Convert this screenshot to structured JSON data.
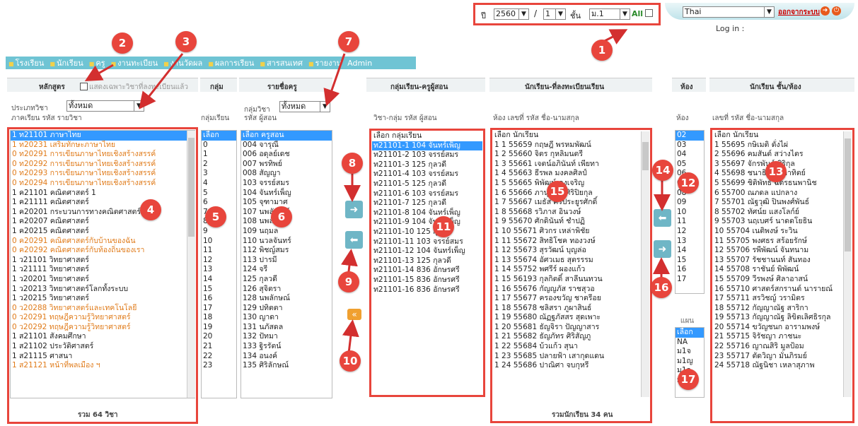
{
  "top": {
    "year_label": "ปี",
    "year_value": "2560",
    "slash": "/",
    "term_value": "1",
    "grade_label": "ชั้น",
    "grade_value": "ม.1",
    "all_label": "All",
    "language": "Thai",
    "logout": "ออกจากระบบ",
    "login_label": "Log in :"
  },
  "menu": [
    "โรงเรียน",
    "นักเรียน",
    "ครู",
    "งานทะเบียน",
    "งานวัดผล",
    "ผลการเรียน",
    "สารสนเทศ",
    "รายงาน",
    "Admin"
  ],
  "col1": {
    "header": "หลักสูตร",
    "checkbox_label": "แสดงเฉพาะวิชาที่ลงทะเบียนแล้ว",
    "type_label": "ประเภทวิชา",
    "type_value": "ทั้งหมด",
    "sub": "ภาคเรียน  รหัส  รายวิชา",
    "footer": "รวม  64 วิชา",
    "items": [
      {
        "t": "1 ท21101 ภาษาไทย",
        "c": "hl"
      },
      {
        "t": "1 ท20231 เสริมทักษะภาษาไทย",
        "c": "o"
      },
      {
        "t": "0 ท20291 การเขียนภาษาไทยเชิงสร้างสรรค์",
        "c": "o"
      },
      {
        "t": "0 ท20292 การเขียนภาษาไทยเชิงสร้างสรรค์",
        "c": "o"
      },
      {
        "t": "0 ท20293 การเขียนภาษาไทยเชิงสร้างสรรค์",
        "c": "o"
      },
      {
        "t": "0 ท20294 การเขียนภาษาไทยเชิงสร้างสรรค์",
        "c": "o"
      },
      {
        "t": "1 ค21101 คณิตศาสตร์ 1",
        "c": ""
      },
      {
        "t": "1 ค21111 คณิตศาสตร์",
        "c": ""
      },
      {
        "t": "1 ค20201 กระบวนการทางคณิตศาสตร์",
        "c": ""
      },
      {
        "t": "1 ค20207 คณิตศาสตร์",
        "c": ""
      },
      {
        "t": "1 ค20215 คณิตศาสตร์",
        "c": ""
      },
      {
        "t": "0 ค20291 คณิตศาสตร์กับบ้านของฉัน",
        "c": "o"
      },
      {
        "t": "0 ค20292 คณิตศาสตร์กับท้องถิ่นของเรา",
        "c": "o"
      },
      {
        "t": "1 ว21101 วิทยาศาสตร์",
        "c": ""
      },
      {
        "t": "1 ว21111 วิทยาศาสตร์",
        "c": ""
      },
      {
        "t": "1 ว20201 วิทยาศาสตร์",
        "c": ""
      },
      {
        "t": "1 ว20213 วิทยาศาสตร์โลกทั้งระบบ",
        "c": ""
      },
      {
        "t": "1 ว20215 วิทยาศาสตร์",
        "c": ""
      },
      {
        "t": "0 ว20288 วิทยาศาสตร์และเทคโนโลยี",
        "c": "o"
      },
      {
        "t": "0 ว20291 ทฤษฎีความรู้วิทยาศาสตร์",
        "c": "o"
      },
      {
        "t": "0 ว20292 ทฤษฎีความรู้วิทยาศาสตร์",
        "c": "o"
      },
      {
        "t": "1 ส21101 สังคมศึกษา",
        "c": ""
      },
      {
        "t": "1 ส21102 ประวัติศาสตร์",
        "c": ""
      },
      {
        "t": "1 ส21115 ศาสนา",
        "c": ""
      },
      {
        "t": "1 ส21121 หน้าที่พลเมือง ฯ",
        "c": "o"
      }
    ]
  },
  "col2": {
    "header": "กลุ่ม",
    "sub": "กลุ่มเรียน",
    "items": [
      "เลือก",
      "0",
      "1",
      "2",
      "3",
      "4",
      "5",
      "6",
      "7",
      "8",
      "9",
      "10",
      "11",
      "12",
      "13",
      "14",
      "15",
      "16",
      "17",
      "18",
      "19",
      "20",
      "21",
      "22",
      "23"
    ]
  },
  "col3": {
    "header": "รายชื่อครู",
    "group_label": "กลุ่มวิชา",
    "group_value": "ทั้งหมด",
    "sub": "รหัส  ผู้สอน",
    "items": [
      "เลือก ครูสอน",
      "004 จารุณี",
      "006 อดุลย์เดช",
      "007 พรทิพย์",
      "008 สัญญา",
      "103 จรรย์สมร",
      "104 จันทร์เพ็ญ",
      "105 จุฑามาศ",
      "107 นพลักษณ์",
      "108 นพลักษณ์",
      "109 นฤมล",
      "110 นวลจันทร์",
      "112 พิชญ์สมร",
      "113 ปารมี",
      "124 จรี",
      "125 กุลวดี",
      "126 สุจิตรา",
      "128 นพลักษณ์",
      "129 ปทิตตา",
      "130 ญาดา",
      "131 นภัสดล",
      "132 ปัทมา",
      "133 ฐิรรัตน์",
      "134 อนงค์",
      "135 ศิริลักษณ์"
    ]
  },
  "col4": {
    "header": "กลุ่มเรียน-ครูผู้สอน",
    "sub": "วิชา-กลุ่ม  รหัส  ผู้สอน",
    "items": [
      "เลือก กลุ่มเรียน",
      "ท21101-1 104 จันทร์เพ็ญ",
      "ท21101-2 103 จรรย์สมร",
      "ท21101-3 125 กุลวดี",
      "ท21101-4 103 จรรย์สมร",
      "ท21101-5 125 กุลวดี",
      "ท21101-6 103 จรรย์สมร",
      "ท21101-7 125 กุลวดี",
      "ท21101-8 104 จันทร์เพ็ญ",
      "ท21101-9 104 จันทร์เพ็ญ",
      "ท21101-10 125 กุลวดี",
      "ท21101-11 103 จรรย์สมร",
      "ท21101-12 104 จันทร์เพ็ญ",
      "ท21101-13 125 กุลวดี",
      "ท21101-14 836 อักษรศรี",
      "ท21101-15 836 อักษรศรี",
      "ท21101-16 836 อักษรศรี"
    ]
  },
  "col5": {
    "header": "นักเรียน-ที่ลงทะเบียนเรียน",
    "sub": "ห้อง  เลขที่  รหัส  ชื่อ-นามสกุล",
    "footer": "รวมนักเรียน  34 คน",
    "items": [
      "เลือก นักเรียน",
      "1 1 55659 กฤษฎี พรหมพัฒน์",
      "1 2 55660 จิตร กุหลิมนตรี",
      "1 3 55661 เจตน์อภินันท์ เพียทา",
      "1 4 55663 ธีรพล มงคลศิลป์",
      "1 5 55665 พิพัฒน์ คงเจริญ",
      "1 6 55666 ภานุ เรืองศิริปิยกุล",
      "1 7 55667 เมธัส ศิริประยูรศักดิ์",
      "1 8 55668 รวิภาส อินวงษ์",
      "1 9 55670 ศักดินันท์ ชำปฏิ",
      "1 10 55671 ศิวกร เหล่าพิชัย",
      "1 11 55672 สิทธิโชค ทองวงษ์",
      "1 12 55673 สุรวัฒน์ บุญล่อ",
      "1 13 55674 อัศวเมธ สุตรรรม",
      "1 14 55752 พศรีร์ ผองแก้ว",
      "1 15 56193 กุลกิตติ์ สาลีนนทวน",
      "1 16 55676 กัญญภัส ราชสุวอ",
      "1 17 55677 ครองขวัญ ชาตรีอย",
      "1 18 55678 ชลิสรา ภูผาสินธ์",
      "1 19 55680 ณัฏฐภัสสร สุดเพาะ",
      "1 20 55681 ธัญจิรา ปัญญาสาร",
      "1 21 55682 ธัญภัทร ศิริสัญภู",
      "1 22 55684 บ้วแก้ว สุนา",
      "1 23 55685 ปลายฟ้า เสากุดแดน",
      "1 24 55686 ปาณิศา จบกุหรี"
    ]
  },
  "col6": {
    "header": "ห้อง",
    "sub": "ห้อง",
    "items": [
      "02",
      "03",
      "04",
      "05",
      "06",
      "07",
      "08",
      "09",
      "10",
      "11",
      "12",
      "13",
      "14",
      "15",
      "16",
      "17"
    ],
    "plan_header": "แผน",
    "plan_items": [
      "เลือก",
      "NA",
      "ม1จ",
      "ม1ญ",
      "ม1จ",
      "ม22"
    ]
  },
  "col7": {
    "header": "นักเรียน  ชั้น/ห้อง",
    "sub": "เลขที่  รหัส  ชื่อ-นามสกุล",
    "items": [
      "เลือก นักเรียน",
      "1 55695 กษิเมติ ดั่งไผ่",
      "2 55696 คมสันต์ สว่างไตร",
      "3 55697 จักรพันธ์ ศิริกุล",
      "4 55698 ชนาธิป จันอาทิตย์",
      "5 55699 ชิติพัทธ์ ฉัตรธนพานิช",
      "6 55700 ณภดล แปกลาง",
      "7 55701 ณัฐวุฒิ ปินพงศ์พันธ์",
      "8 55702 ทัศน์ย แสงโลก์ย์",
      "9 55703 นฤเบศร์ นาดดโยธิน",
      "10 55704 เนติพงษ์ ระวิน",
      "11 55705 พงศธร สร้อยรักษ์",
      "12 55706 รพีพัฒน์ จันทนาม",
      "13 55707 รัชชานนท์ สันทอง",
      "14 55708 ราชันย์ พิพัฒน์",
      "15 55709 วีรพงษ์ ศิลาอาสน์",
      "16 55710 ศาสตร์สกรานต์ นารายณ์",
      "17 55711 สรวิชญ์ วรามิตร",
      "18 55712 กัญญาณัฐ สาริกา",
      "19 55713 กัญญาณัฐ ลิขิตเลิศธิรกุล",
      "20 55714 ขวัญชนก อารามพงษ์",
      "21 55715 จิรัชญา ภาชนะ",
      "22 55716 ญาณสิริ มูลป้อม",
      "23 55717 ตัดวิญา มั่นภิรมย์",
      "24 55718 ณัฐนิชา เหลาสุภาพ"
    ]
  },
  "badges": [
    "1",
    "2",
    "3",
    "4",
    "5",
    "6",
    "7",
    "8",
    "9",
    "10",
    "11",
    "12",
    "13",
    "14",
    "15",
    "16",
    "17"
  ],
  "buttons": {
    "move_right": "➜",
    "move_left": "⬅",
    "move_all": "«"
  }
}
